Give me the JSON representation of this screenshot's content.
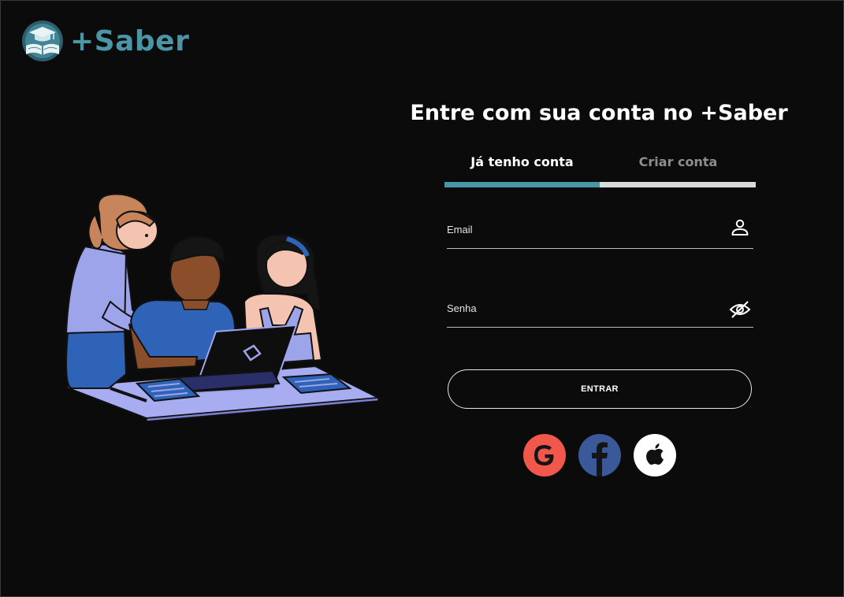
{
  "brand": {
    "name": "+Saber",
    "colors": {
      "primary": "#4a95a6",
      "background": "#0b0b0b"
    }
  },
  "login": {
    "heading": "Entre com sua conta no +Saber",
    "tabs": [
      {
        "label": "Já tenho conta",
        "active": true
      },
      {
        "label": "Criar conta",
        "active": false
      }
    ],
    "email": {
      "label": "Email",
      "icon": "user-icon"
    },
    "password": {
      "label": "Senha",
      "icon": "eye-slash-icon"
    },
    "submit_label": "ENTRAR",
    "social": [
      {
        "provider": "Google",
        "icon": "google-icon",
        "color": "#f1574a"
      },
      {
        "provider": "Facebook",
        "icon": "facebook-icon",
        "color": "#3b5998"
      },
      {
        "provider": "Apple",
        "icon": "apple-icon",
        "color": "#ffffff"
      }
    ]
  }
}
